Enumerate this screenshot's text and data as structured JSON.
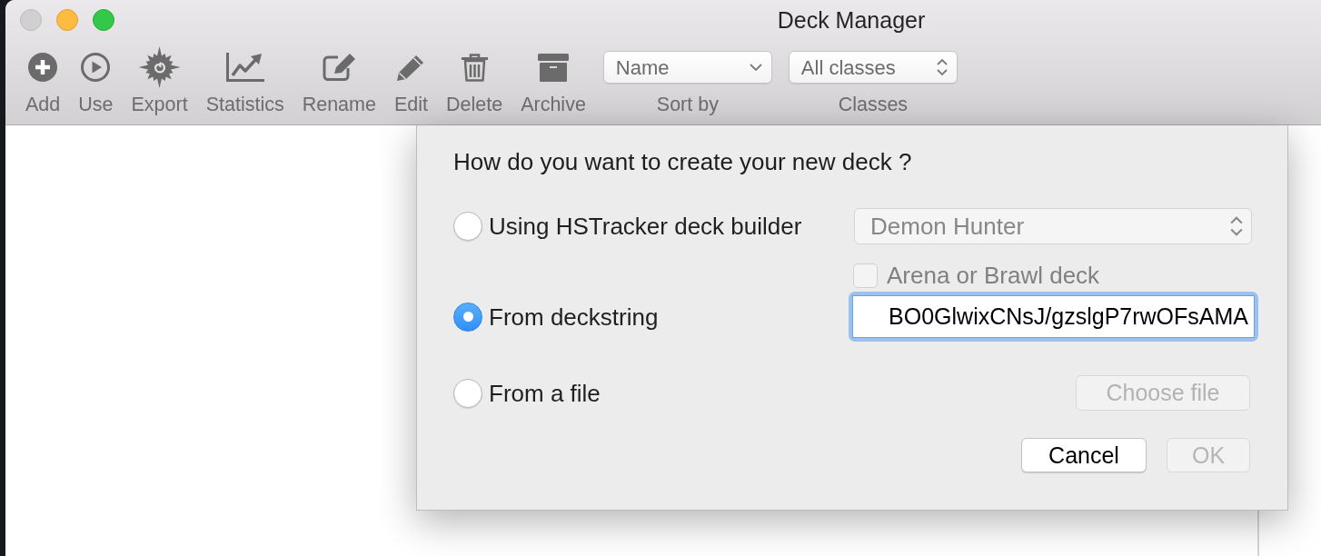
{
  "window": {
    "title": "Deck Manager",
    "controls": [
      {
        "kind": "close",
        "disabled": true
      },
      {
        "kind": "minimize",
        "disabled": false
      },
      {
        "kind": "zoom",
        "disabled": false
      }
    ]
  },
  "toolbar": {
    "items": [
      {
        "label": "Add"
      },
      {
        "label": "Use"
      },
      {
        "label": "Export"
      },
      {
        "label": "Statistics"
      },
      {
        "label": "Rename"
      },
      {
        "label": "Edit"
      },
      {
        "label": "Delete"
      },
      {
        "label": "Archive"
      }
    ],
    "dropdowns": [
      {
        "kind": "pulldown",
        "value": "Name",
        "label": "Sort by"
      },
      {
        "kind": "popup",
        "value": "All classes",
        "label": "Classes"
      }
    ]
  },
  "dialog": {
    "question": "How do you want to create your new deck ?",
    "options": [
      {
        "kind": "builder",
        "label": "Using HSTracker deck builder",
        "selected": false,
        "class_select": {
          "value": "Demon Hunter",
          "disabled": true
        },
        "arena_checkbox": {
          "label": "Arena or Brawl deck",
          "checked": false,
          "disabled": true
        }
      },
      {
        "kind": "deckstring",
        "label": "From deckstring",
        "selected": true,
        "field": {
          "value": "BO0GlwixCNsJ/gzslgP7rwOFsAMA",
          "focused": true
        }
      },
      {
        "kind": "file",
        "label": "From a file",
        "selected": false,
        "button": {
          "label": "Choose file",
          "disabled": true
        }
      }
    ],
    "buttons": [
      {
        "label": "Cancel",
        "disabled": false
      },
      {
        "label": "OK",
        "disabled": true
      }
    ]
  }
}
